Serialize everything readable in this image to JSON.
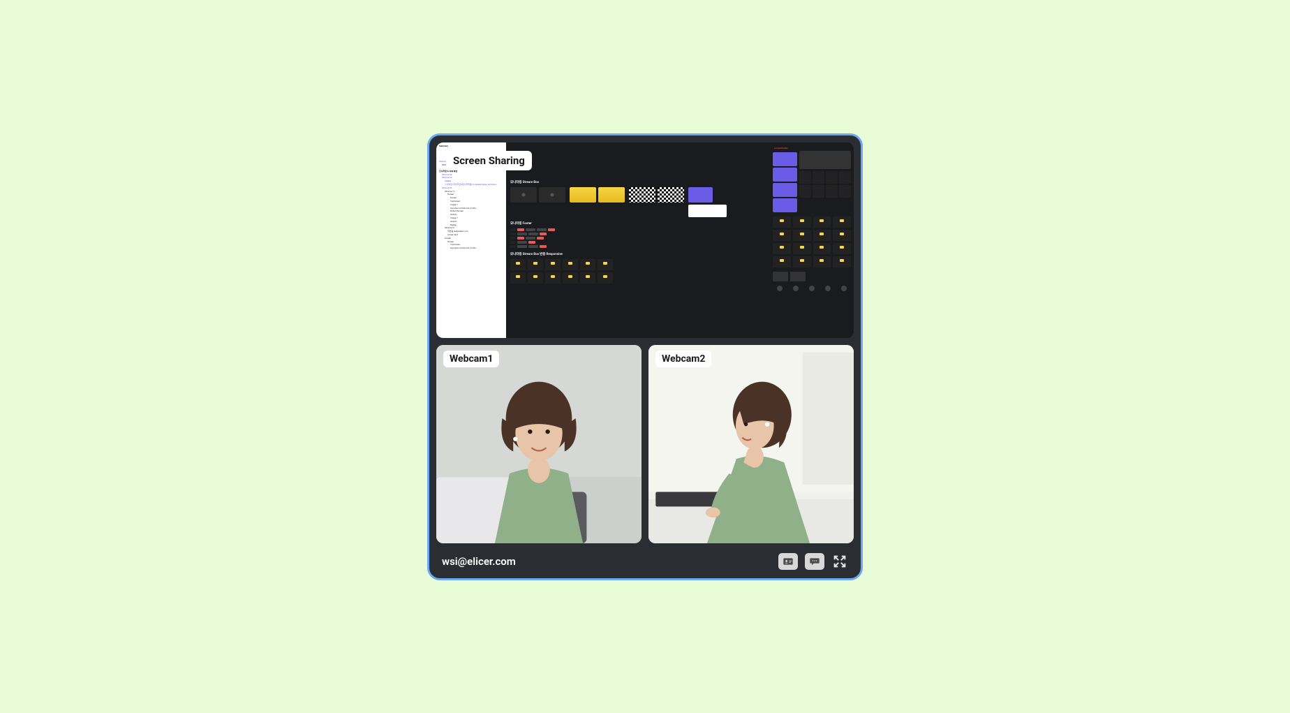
{
  "panels": {
    "screenshare": {
      "label": "Screen Sharing"
    },
    "webcam1": {
      "label": "Webcam1"
    },
    "webcam2": {
      "label": "Webcam2"
    }
  },
  "footer": {
    "email": "wsi@elicer.com"
  },
  "screenshare_detail": {
    "tree_header": "Summary",
    "tree_section": "모니터링 & 녹화 화면",
    "tree_items": [
      "#Lecture Viewer",
      "#Frame 4",
      "#Frame 50",
      "#Frame 50",
      "Cursor",
      "수강화면/학습학습화면/콜백캠/completemerge_autosave",
      "#Frame 56",
      "#Frame 12",
      "Screen",
      "Screen",
      "TopScreen",
      "Image 7",
      "sign-discord-discord-of-stbi...",
      "BottomScreen",
      "stream",
      "Image 7",
      "stream",
      "Badge",
      "#Frame 51",
      "학습중 lee@eibae.com",
      "screen text",
      "Screen",
      "Screen",
      "TopScreen",
      "sign-discord-discord-of-stbi..."
    ],
    "sections": [
      "모니터링 Stream Box",
      "모니터링 Footer",
      "모니터링 Stream Box 반응 Responsive"
    ],
    "right_header": "LectureHeader"
  },
  "icons": {
    "contact": "contact-card-icon",
    "chat": "chat-icon",
    "expand": "expand-icon"
  }
}
